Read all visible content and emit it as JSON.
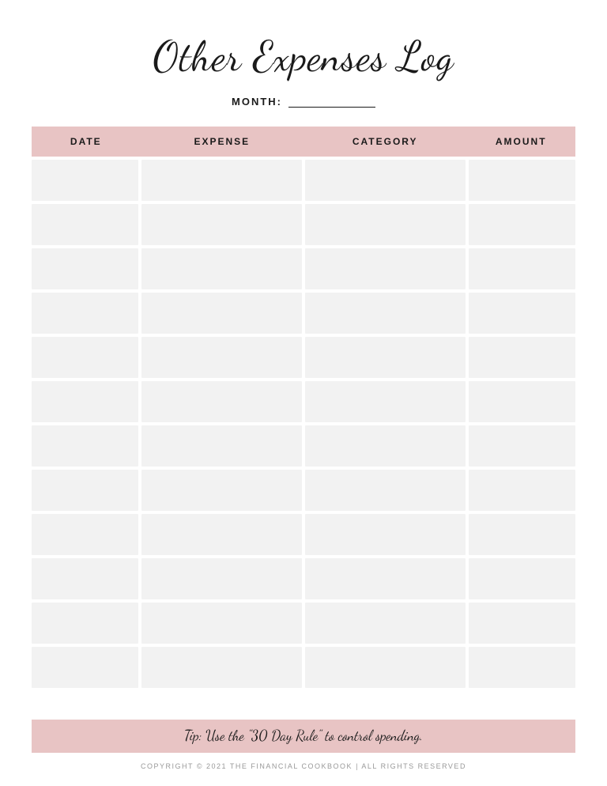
{
  "header": {
    "title": "Other Expenses Log",
    "month_label": "MONTH:",
    "month_value": ""
  },
  "table": {
    "columns": [
      {
        "key": "date",
        "label": "DATE"
      },
      {
        "key": "expense",
        "label": "EXPENSE"
      },
      {
        "key": "category",
        "label": "CATEGORY"
      },
      {
        "key": "amount",
        "label": "AMOUNT"
      }
    ],
    "row_count": 12
  },
  "tip": {
    "text": "Tip: Use the \"30 Day Rule\" to control spending."
  },
  "footer": {
    "copyright": "COPYRIGHT © 2021 THE FINANCIAL COOKBOOK | ALL RIGHTS RESERVED"
  }
}
